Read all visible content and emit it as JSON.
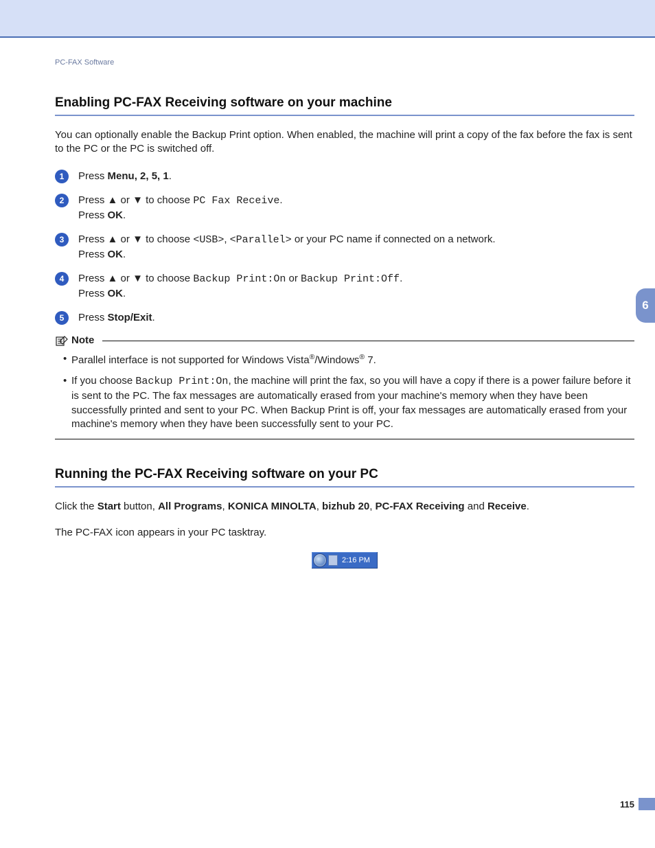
{
  "header": {
    "breadcrumb": "PC-FAX Software"
  },
  "chapter_tab": "6",
  "page_number": "115",
  "section1": {
    "heading": "Enabling PC-FAX Receiving software on your machine",
    "intro": "You can optionally enable the Backup Print option. When enabled, the machine will print a copy of the fax before the fax is sent to the PC or the PC is switched off.",
    "steps": {
      "s1": {
        "press": "Press ",
        "menu": "Menu",
        "keys": ", 2, 5, 1",
        "dot": "."
      },
      "s2": {
        "press": "Press ",
        "up": "▲",
        "or": " or ",
        "down": "▼",
        "choose": " to choose ",
        "val": "PC Fax Receive",
        "dot": ".",
        "press2": "Press ",
        "ok": "OK",
        "dot2": "."
      },
      "s3": {
        "press": "Press ",
        "up": "▲",
        "or": " or ",
        "down": "▼",
        "choose": " to choose ",
        "usb": "<USB>",
        "comma": ", ",
        "parallel": "<Parallel>",
        "rest": " or your PC name if connected on a network.",
        "press2": "Press ",
        "ok": "OK",
        "dot2": "."
      },
      "s4": {
        "press": "Press ",
        "up": "▲",
        "or": " or ",
        "down": "▼",
        "choose": " to choose ",
        "bp_on": "Backup Print:On",
        "or2": " or ",
        "bp_off": "Backup Print:Off",
        "dot": ".",
        "press2": "Press ",
        "ok": "OK",
        "dot2": "."
      },
      "s5": {
        "press": "Press ",
        "stop": "Stop/Exit",
        "dot": "."
      }
    }
  },
  "note": {
    "label": "Note",
    "items": {
      "n1": {
        "t1": "Parallel interface is not supported for Windows Vista",
        "reg1": "®",
        "t2": "/Windows",
        "reg2": "®",
        "t3": " 7."
      },
      "n2": {
        "t1": "If you choose ",
        "bp_on": "Backup Print:On",
        "t2": ", the machine will print the fax, so you will have a copy if there is a power failure before it is sent to the PC. The fax messages are automatically erased from your machine's memory when they have been successfully printed and sent to your PC. When Backup Print is off, your fax messages are automatically erased from your machine's memory when they have been successfully sent to your PC."
      }
    }
  },
  "section2": {
    "heading": "Running the PC-FAX Receiving software on your PC",
    "line1": {
      "t1": "Click the ",
      "start": "Start",
      "t2": " button, ",
      "all": "All Programs",
      "c1": ", ",
      "km": "KONICA MINOLTA",
      "c2": ", ",
      "bh": "bizhub 20",
      "c3": ", ",
      "rx": "PC-FAX Receiving",
      "t3": " and ",
      "rv": "Receive",
      "dot": "."
    },
    "line2": "The PC-FAX icon appears in your PC tasktray.",
    "tray_time": "2:16 PM"
  }
}
